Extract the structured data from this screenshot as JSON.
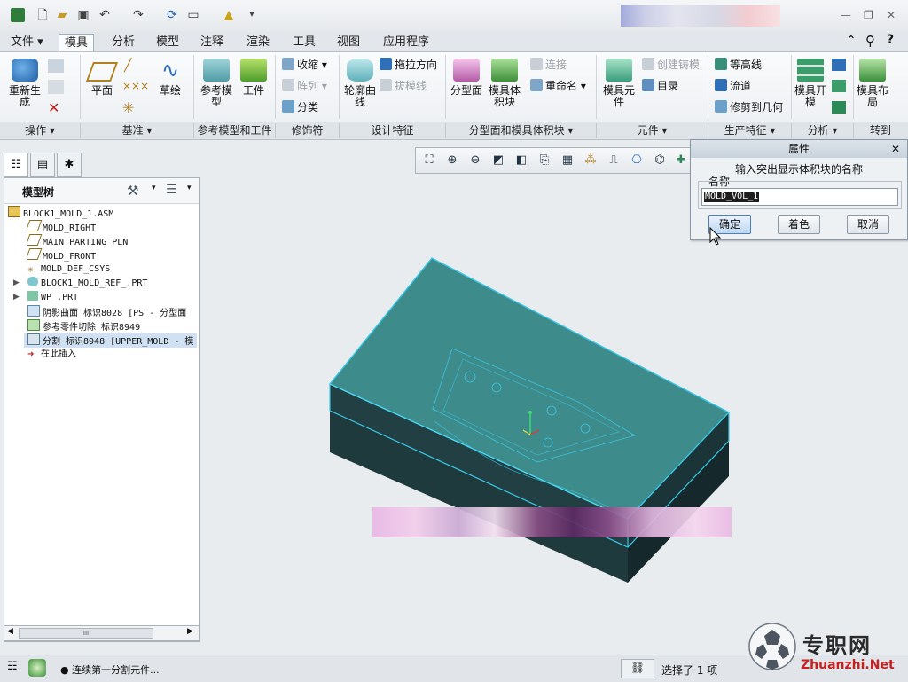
{
  "ribbon": {
    "tabs": [
      "文件 ▾",
      "模具",
      "分析",
      "模型",
      "注释",
      "渲染",
      "工具",
      "视图",
      "应用程序"
    ],
    "active_tab": "模具",
    "buttons": {
      "regenerate": "重新生成",
      "plane": "平面",
      "sketch": "草绘",
      "ref_model": "参考模型",
      "workpiece": "工件",
      "shrink": "收缩",
      "pattern": "阵列",
      "classify": "分类",
      "silhouette_curve": "轮廓曲线",
      "drag_direction": "拖拉方向",
      "draft_line": "拔模线",
      "parting_surface": "分型面",
      "mold_volume": "模具体积块",
      "connect": "连接",
      "rename": "重命名",
      "mold_component": "模具元件",
      "create_casting": "创建铸模",
      "catalog": "目录",
      "contour": "等高线",
      "flow": "流道",
      "trim_to_geometry": "修剪到几何",
      "mold_open": "模具开模",
      "mold_layout": "模具布局"
    },
    "groups": [
      "操作 ▾",
      "基准 ▾",
      "参考模型和工件",
      "修饰符",
      "设计特征",
      "分型面和模具体积块 ▾",
      "元件 ▾",
      "生产特征 ▾",
      "分析 ▾",
      "转到"
    ]
  },
  "model_tree": {
    "title": "模型树",
    "items": [
      "BLOCK1_MOLD_1.ASM",
      "MOLD_RIGHT",
      "MAIN_PARTING_PLN",
      "MOLD_FRONT",
      "MOLD_DEF_CSYS",
      "BLOCK1_MOLD_REF_.PRT",
      "WP_.PRT",
      "阴影曲面 标识8028 [PS - 分型面",
      "参考零件切除 标识8949",
      "分割 标识8948 [UPPER_MOLD - 模",
      "在此插入"
    ],
    "scroll_label": "III"
  },
  "dialog": {
    "title": "属性",
    "prompt": "输入突出显示体积块的名称",
    "name_label": "名称",
    "name_value": "MOLD_VOL_1",
    "ok": "确定",
    "shade": "着色",
    "cancel": "取消"
  },
  "status": {
    "message": "● 连续第一分割元件...",
    "selection": "选择了 1 项"
  },
  "watermark": {
    "cn": "专职网",
    "url": "Zhuanzhi.Net"
  },
  "colors": {
    "mold_top": "#3d8b8a",
    "mold_side": "#1f3f44",
    "mold_edge": "#39c8e8"
  }
}
